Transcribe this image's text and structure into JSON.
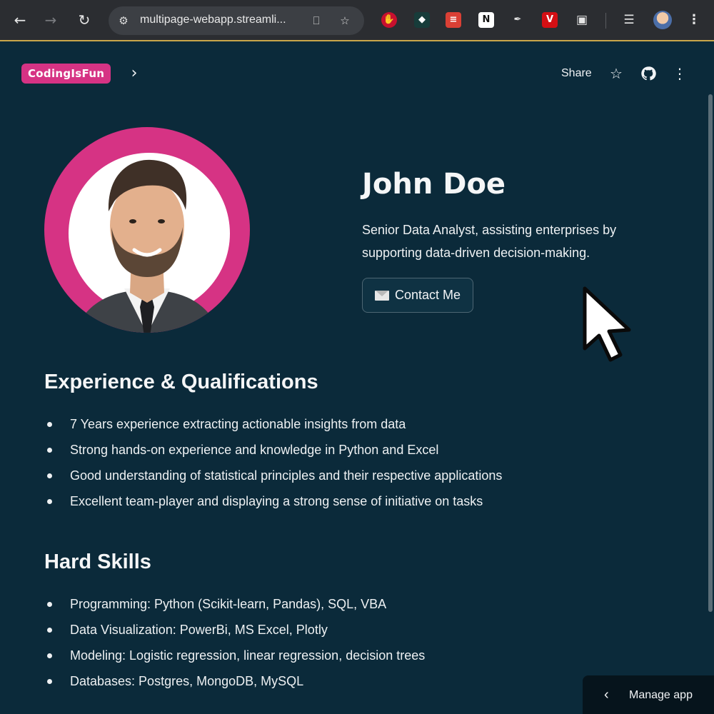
{
  "browser": {
    "url": "multipage-webapp.streamli...",
    "nav": {
      "back_icon": "arrow-left",
      "forward_icon": "arrow-right",
      "reload_icon": "reload"
    },
    "extensions": [
      "ublock-icon",
      "dark-extension-icon",
      "todoist-icon",
      "notion-icon",
      "eyedropper-icon",
      "vivaldi-icon",
      "puzzle-icon"
    ]
  },
  "header": {
    "logo": "CodingIsFun",
    "share": "Share",
    "accent": "#d63384"
  },
  "profile": {
    "name": "John Doe",
    "bio": "Senior Data Analyst, assisting enterprises by supporting data-driven decision-making.",
    "contact_button": "Contact Me"
  },
  "experience": {
    "title": "Experience & Qualifications",
    "items": [
      "7 Years experience extracting actionable insights from data",
      "Strong hands-on experience and knowledge in Python and Excel",
      "Good understanding of statistical principles and their respective applications",
      "Excellent team-player and displaying a strong sense of initiative on tasks"
    ]
  },
  "skills": {
    "title": "Hard Skills",
    "items": [
      "Programming: Python (Scikit-learn, Pandas), SQL, VBA",
      "Data Visualization: PowerBi, MS Excel, Plotly",
      "Modeling: Logistic regression, linear regression, decision trees",
      "Databases: Postgres, MongoDB, MySQL"
    ]
  },
  "manage_app": {
    "label": "Manage app"
  },
  "colors": {
    "background": "#0b2a3a",
    "text": "#f2f4f6"
  }
}
